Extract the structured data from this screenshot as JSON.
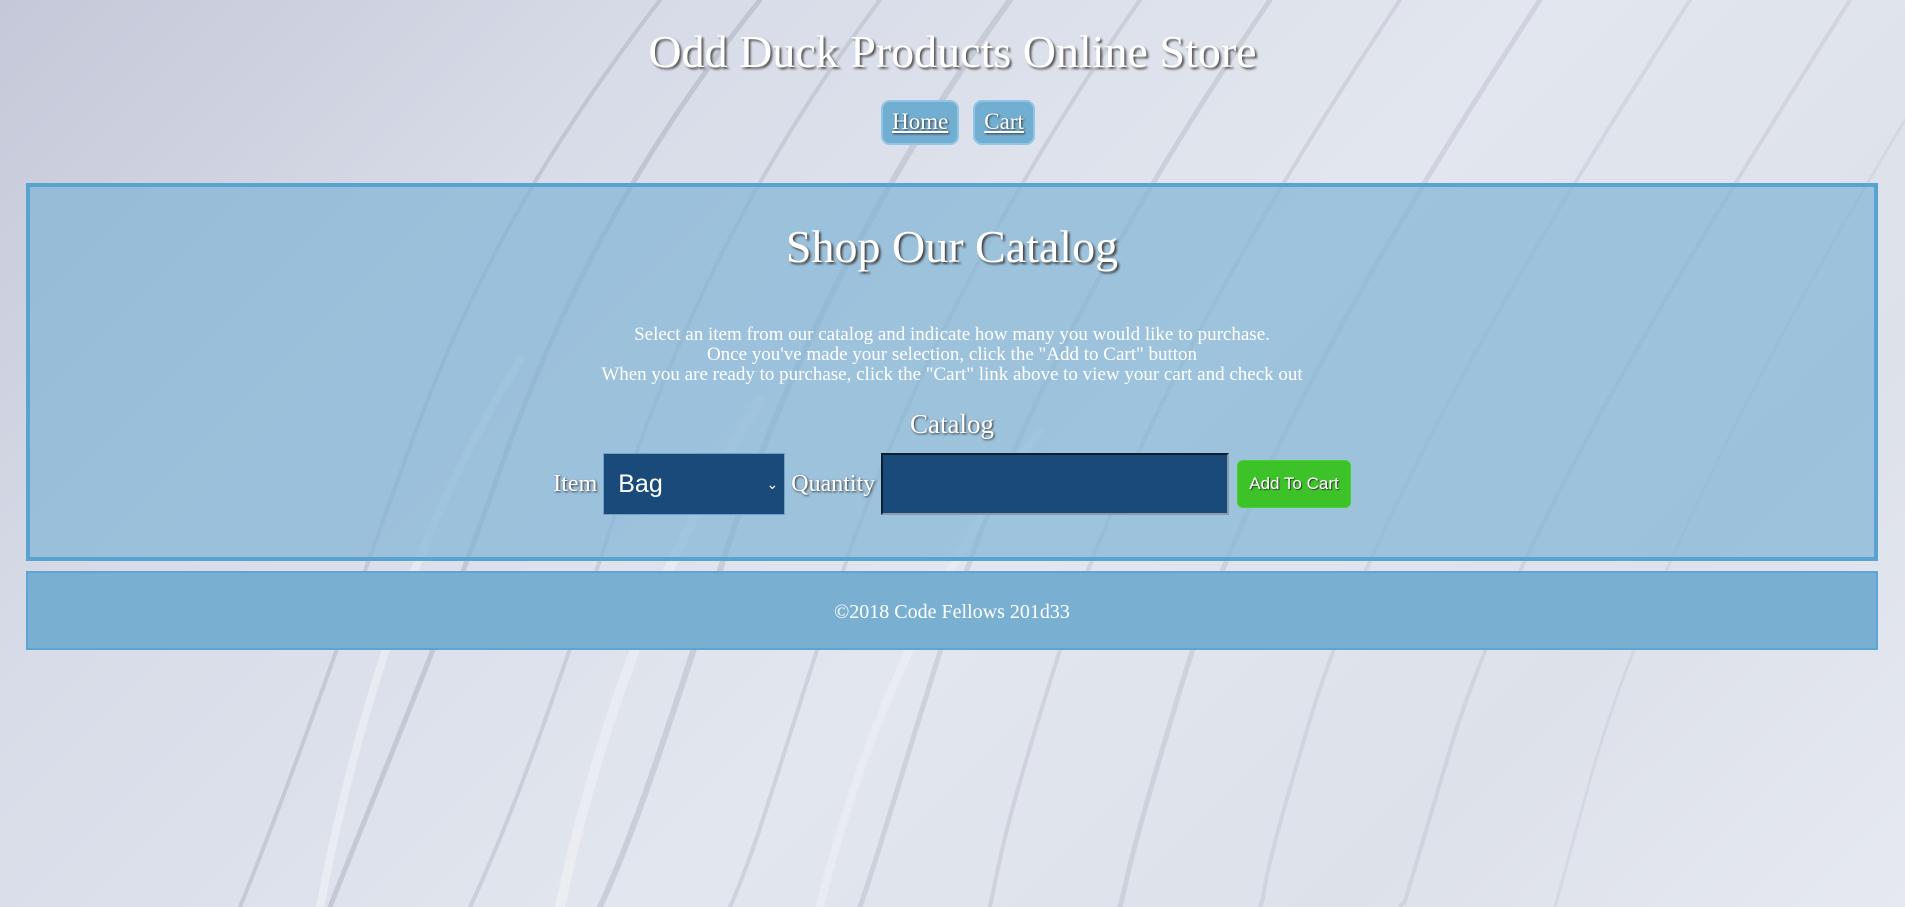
{
  "header": {
    "title": "Odd Duck Products Online Store",
    "nav": {
      "home_label": "Home",
      "cart_label": "Cart"
    }
  },
  "catalog": {
    "heading": "Shop Our Catalog",
    "instructions": [
      "Select an item from our catalog and indicate how many you would like to purchase.",
      "Once you've made your selection, click the \"Add to Cart\" button",
      "When you are ready to purchase, click the \"Cart\" link above to view your cart and check out"
    ],
    "subheading": "Catalog",
    "form": {
      "item_label": "Item",
      "item_selected": "Bag",
      "quantity_label": "Quantity",
      "quantity_value": "",
      "button_label": "Add To Cart"
    }
  },
  "footer": {
    "text": "©2018 Code Fellows 201d33"
  },
  "colors": {
    "panel_border": "#5aa2d0",
    "nav_button": "#72aed2",
    "input_bg": "#1a4a7a",
    "button_green": "#3ec22a",
    "footer_bg": "#79b0d2"
  },
  "icons": {
    "select_arrow": "chevron-down-icon"
  }
}
